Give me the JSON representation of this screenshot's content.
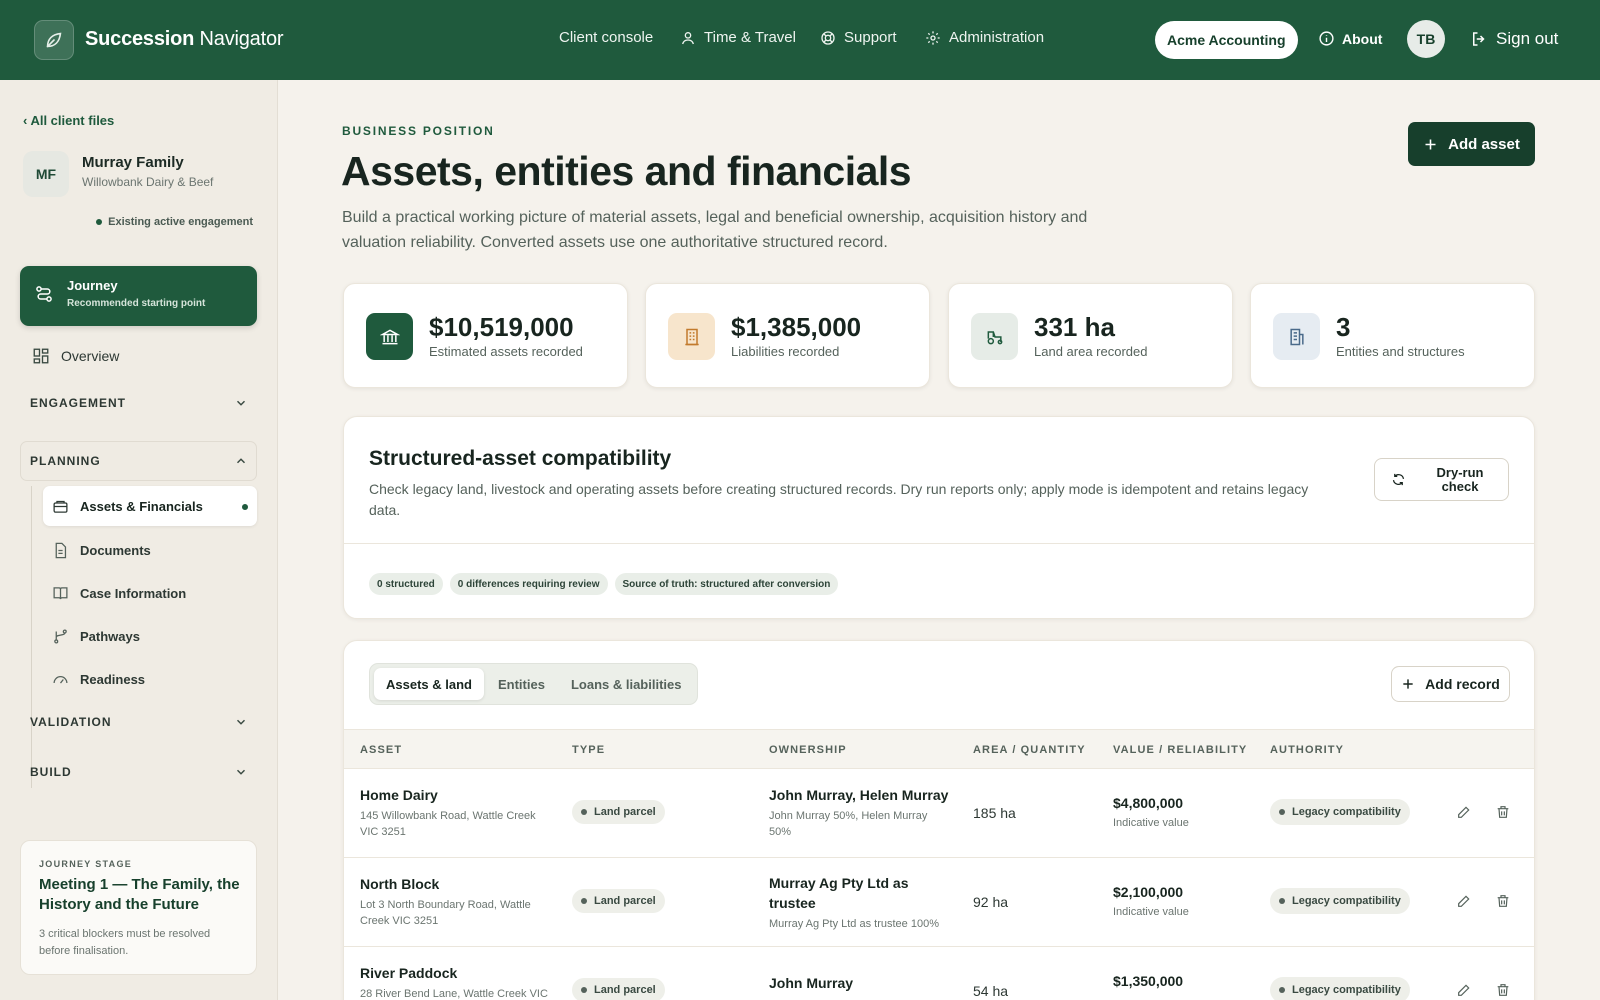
{
  "app": {
    "brand_bold": "Succession",
    "brand_rest": "Navigator",
    "nav": [
      "Client console",
      "Time & Travel",
      "Support",
      "Administration"
    ],
    "org": "Acme Accounting",
    "about": "About",
    "user_initials": "TB",
    "sign_out": "Sign out",
    "accent": "#1f5a3d"
  },
  "sidebar": {
    "back": "‹ All client files",
    "client_initials": "MF",
    "client_name": "Murray Family",
    "client_sub": "Willowbank Dairy & Beef",
    "engagement": "Existing active engagement",
    "journey_title": "Journey",
    "journey_sub": "Recommended starting point",
    "overview": "Overview",
    "sections": {
      "engagement": "ENGAGEMENT",
      "planning": "PLANNING",
      "validation": "VALIDATION",
      "build": "BUILD"
    },
    "planning_items": [
      "Assets & Financials",
      "Documents",
      "Case Information",
      "Pathways",
      "Readiness"
    ],
    "stage_label": "JOURNEY STAGE",
    "stage_title": "Meeting 1 — The Family, the History and the Future",
    "stage_note": "3 critical blockers must be resolved before finalisation."
  },
  "page": {
    "eyebrow": "BUSINESS POSITION",
    "title": "Assets, entities and financials",
    "lead": "Build a practical working picture of material assets, legal and beneficial ownership, acquisition history and valuation reliability. Converted assets use one authoritative structured record.",
    "add_asset": "Add asset"
  },
  "stats": [
    {
      "value": "$10,519,000",
      "label": "Estimated assets recorded",
      "icon": "bank-icon"
    },
    {
      "value": "$1,385,000",
      "label": "Liabilities recorded",
      "icon": "building-icon"
    },
    {
      "value": "331 ha",
      "label": "Land area recorded",
      "icon": "tractor-icon"
    },
    {
      "value": "3",
      "label": "Entities and structures",
      "icon": "office-icon"
    }
  ],
  "compat": {
    "title": "Structured-asset compatibility",
    "desc": "Check legacy land, livestock and operating assets before creating structured records. Dry run reports only; apply mode is idempotent and retains legacy data.",
    "dry_run": "Dry-run check",
    "chips": [
      "0 structured",
      "0 differences requiring review",
      "Source of truth: structured after conversion"
    ]
  },
  "records": {
    "tabs": [
      "Assets & land",
      "Entities",
      "Loans & liabilities"
    ],
    "add_record": "Add record",
    "columns": [
      "ASSET",
      "TYPE",
      "OWNERSHIP",
      "AREA / QUANTITY",
      "VALUE / RELIABILITY",
      "AUTHORITY"
    ],
    "rows": [
      {
        "name": "Home Dairy",
        "address": "145 Willowbank Road, Wattle Creek VIC 3251",
        "type": "Land parcel",
        "owner": "John Murray, Helen Murray",
        "owner_detail": "John Murray 50%, Helen Murray 50%",
        "area": "185 ha",
        "value": "$4,800,000",
        "value_note": "Indicative value",
        "authority": "Legacy compatibility"
      },
      {
        "name": "North Block",
        "address": "Lot 3 North Boundary Road, Wattle Creek VIC 3251",
        "type": "Land parcel",
        "owner": "Murray Ag Pty Ltd as trustee",
        "owner_detail": "Murray Ag Pty Ltd as trustee 100%",
        "area": "92 ha",
        "value": "$2,100,000",
        "value_note": "Indicative value",
        "authority": "Legacy compatibility"
      },
      {
        "name": "River Paddock",
        "address": "28 River Bend Lane, Wattle Creek VIC",
        "type": "Land parcel",
        "owner": "John Murray",
        "owner_detail": "",
        "area": "54 ha",
        "value": "$1,350,000",
        "value_note": "",
        "authority": "Legacy compatibility"
      }
    ]
  }
}
